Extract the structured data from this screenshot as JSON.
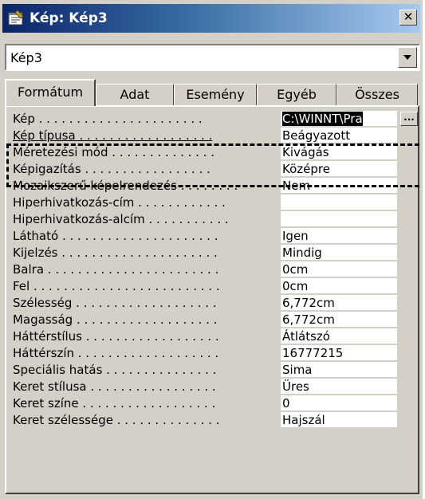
{
  "window": {
    "title": "Kép: Kép3"
  },
  "object_select": {
    "value": "Kép3"
  },
  "tabs": [
    {
      "label": "Formátum",
      "active": true
    },
    {
      "label": "Adat",
      "active": false
    },
    {
      "label": "Esemény",
      "active": false
    },
    {
      "label": "Egyéb",
      "active": false
    },
    {
      "label": "Összes",
      "active": false
    }
  ],
  "properties": [
    {
      "label": "Kép . . . . . . . . . . . . . . . . . . . . . .",
      "value": "C:\\WINNT\\Pra"
    },
    {
      "label": "Kép típusa . . . . . . . . . . . . . . . . . .",
      "value": "Beágyazott"
    },
    {
      "label": "Méretezési mód . . . . . . . . . . . . . .",
      "value": "Kivágás"
    },
    {
      "label": "Képigazítás . . . . . . . . . . . . . . . . .",
      "value": "Középre"
    },
    {
      "label": "Mozaikszerű képelrendezés . . . . . . . .",
      "value": "Nem"
    },
    {
      "label": "Hiperhivatkozás-cím . . . . . . . . . . . .",
      "value": ""
    },
    {
      "label": "Hiperhivatkozás-alcím . . . . . . . . . . .",
      "value": ""
    },
    {
      "label": "Látható . . . . . . . . . . . . . . . . . . . . .",
      "value": "Igen"
    },
    {
      "label": "Kijelzés . . . . . . . . . . . . . . . . . . . . .",
      "value": "Mindig"
    },
    {
      "label": "Balra . . . . . . . . . . . . . . . . . . . . . . .",
      "value": "0cm"
    },
    {
      "label": "Fel . . . . . . . . . . . . . . . . . . . . . . . . .",
      "value": "0cm"
    },
    {
      "label": "Szélesség . . . . . . . . . . . . . . . . . . .",
      "value": "6,772cm"
    },
    {
      "label": "Magasság . . . . . . . . . . . . . . . . . . .",
      "value": "6,772cm"
    },
    {
      "label": "Háttérstílus . . . . . . . . . . . . . . . . . .",
      "value": "Átlátszó"
    },
    {
      "label": "Háttérszín . . . . . . . . . . . . . . . . . . .",
      "value": "16777215"
    },
    {
      "label": "Speciális hatás . . . . . . . . . . . . . . .",
      "value": "Sima"
    },
    {
      "label": "Keret stílusa . . . . . . . . . . . . . . . . .",
      "value": "Üres"
    },
    {
      "label": "Keret színe . . . . . . . . . . . . . . . . . .",
      "value": "0"
    },
    {
      "label": "Keret szélessége . . . . . . . . . . . . . .",
      "value": "Hajszál"
    }
  ],
  "colors": {
    "title_start": "#0a246a",
    "title_end": "#a6caf0",
    "face": "#d4d0c8"
  }
}
